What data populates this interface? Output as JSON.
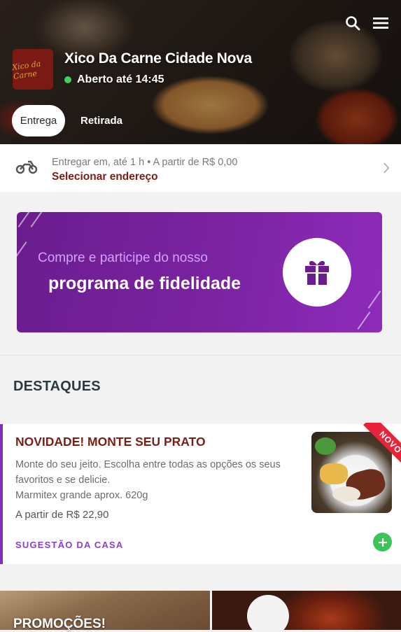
{
  "store": {
    "name": "Xico Da Carne Cidade Nova",
    "status": "Aberto até 14:45",
    "logo_text": "Xico da Carne"
  },
  "header": {
    "icons": [
      "search-icon",
      "menu-icon"
    ]
  },
  "mode_tabs": [
    {
      "label": "Entrega",
      "active": true
    },
    {
      "label": "Retirada",
      "active": false
    }
  ],
  "delivery": {
    "info": "Entregar em, até 1 h  •  A partir de R$ 0,00",
    "address_action": "Selecionar endereço"
  },
  "loyalty_banner": {
    "line1": "Compre e participe do nosso",
    "line2": "programa de fidelidade"
  },
  "highlights": {
    "title": "DESTAQUES",
    "items": [
      {
        "title": "NOVIDADE! MONTE SEU PRATO",
        "description": "Monte do seu jeito. Escolha entre todas as opções os seus favoritos e se delicie.",
        "size": "Marmitex grande aprox. 620g",
        "price": "A partir de R$ 22,90",
        "tag": "SUGESTÃO DA CASA",
        "badge": "NOVO"
      }
    ]
  },
  "promotions": {
    "title": "PROMOÇÕES!"
  },
  "colors": {
    "accent_purple": "#7e2fc0",
    "brand_red": "#7b1f14",
    "status_green": "#3fd15a",
    "add_green": "#3cc45a",
    "badge_red": "#e8233a"
  }
}
